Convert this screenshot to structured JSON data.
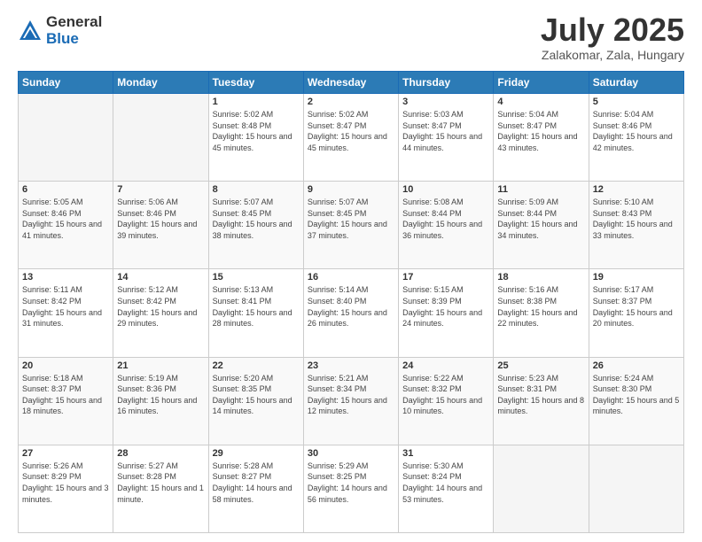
{
  "header": {
    "logo_general": "General",
    "logo_blue": "Blue",
    "title": "July 2025",
    "location": "Zalakomar, Zala, Hungary"
  },
  "days_of_week": [
    "Sunday",
    "Monday",
    "Tuesday",
    "Wednesday",
    "Thursday",
    "Friday",
    "Saturday"
  ],
  "weeks": [
    {
      "days": [
        {
          "num": "",
          "info": ""
        },
        {
          "num": "",
          "info": ""
        },
        {
          "num": "1",
          "sunrise": "5:02 AM",
          "sunset": "8:48 PM",
          "daylight": "15 hours and 45 minutes."
        },
        {
          "num": "2",
          "sunrise": "5:02 AM",
          "sunset": "8:47 PM",
          "daylight": "15 hours and 45 minutes."
        },
        {
          "num": "3",
          "sunrise": "5:03 AM",
          "sunset": "8:47 PM",
          "daylight": "15 hours and 44 minutes."
        },
        {
          "num": "4",
          "sunrise": "5:04 AM",
          "sunset": "8:47 PM",
          "daylight": "15 hours and 43 minutes."
        },
        {
          "num": "5",
          "sunrise": "5:04 AM",
          "sunset": "8:46 PM",
          "daylight": "15 hours and 42 minutes."
        }
      ]
    },
    {
      "shade": true,
      "days": [
        {
          "num": "6",
          "sunrise": "5:05 AM",
          "sunset": "8:46 PM",
          "daylight": "15 hours and 41 minutes."
        },
        {
          "num": "7",
          "sunrise": "5:06 AM",
          "sunset": "8:46 PM",
          "daylight": "15 hours and 39 minutes."
        },
        {
          "num": "8",
          "sunrise": "5:07 AM",
          "sunset": "8:45 PM",
          "daylight": "15 hours and 38 minutes."
        },
        {
          "num": "9",
          "sunrise": "5:07 AM",
          "sunset": "8:45 PM",
          "daylight": "15 hours and 37 minutes."
        },
        {
          "num": "10",
          "sunrise": "5:08 AM",
          "sunset": "8:44 PM",
          "daylight": "15 hours and 36 minutes."
        },
        {
          "num": "11",
          "sunrise": "5:09 AM",
          "sunset": "8:44 PM",
          "daylight": "15 hours and 34 minutes."
        },
        {
          "num": "12",
          "sunrise": "5:10 AM",
          "sunset": "8:43 PM",
          "daylight": "15 hours and 33 minutes."
        }
      ]
    },
    {
      "days": [
        {
          "num": "13",
          "sunrise": "5:11 AM",
          "sunset": "8:42 PM",
          "daylight": "15 hours and 31 minutes."
        },
        {
          "num": "14",
          "sunrise": "5:12 AM",
          "sunset": "8:42 PM",
          "daylight": "15 hours and 29 minutes."
        },
        {
          "num": "15",
          "sunrise": "5:13 AM",
          "sunset": "8:41 PM",
          "daylight": "15 hours and 28 minutes."
        },
        {
          "num": "16",
          "sunrise": "5:14 AM",
          "sunset": "8:40 PM",
          "daylight": "15 hours and 26 minutes."
        },
        {
          "num": "17",
          "sunrise": "5:15 AM",
          "sunset": "8:39 PM",
          "daylight": "15 hours and 24 minutes."
        },
        {
          "num": "18",
          "sunrise": "5:16 AM",
          "sunset": "8:38 PM",
          "daylight": "15 hours and 22 minutes."
        },
        {
          "num": "19",
          "sunrise": "5:17 AM",
          "sunset": "8:37 PM",
          "daylight": "15 hours and 20 minutes."
        }
      ]
    },
    {
      "shade": true,
      "days": [
        {
          "num": "20",
          "sunrise": "5:18 AM",
          "sunset": "8:37 PM",
          "daylight": "15 hours and 18 minutes."
        },
        {
          "num": "21",
          "sunrise": "5:19 AM",
          "sunset": "8:36 PM",
          "daylight": "15 hours and 16 minutes."
        },
        {
          "num": "22",
          "sunrise": "5:20 AM",
          "sunset": "8:35 PM",
          "daylight": "15 hours and 14 minutes."
        },
        {
          "num": "23",
          "sunrise": "5:21 AM",
          "sunset": "8:34 PM",
          "daylight": "15 hours and 12 minutes."
        },
        {
          "num": "24",
          "sunrise": "5:22 AM",
          "sunset": "8:32 PM",
          "daylight": "15 hours and 10 minutes."
        },
        {
          "num": "25",
          "sunrise": "5:23 AM",
          "sunset": "8:31 PM",
          "daylight": "15 hours and 8 minutes."
        },
        {
          "num": "26",
          "sunrise": "5:24 AM",
          "sunset": "8:30 PM",
          "daylight": "15 hours and 5 minutes."
        }
      ]
    },
    {
      "days": [
        {
          "num": "27",
          "sunrise": "5:26 AM",
          "sunset": "8:29 PM",
          "daylight": "15 hours and 3 minutes."
        },
        {
          "num": "28",
          "sunrise": "5:27 AM",
          "sunset": "8:28 PM",
          "daylight": "15 hours and 1 minute."
        },
        {
          "num": "29",
          "sunrise": "5:28 AM",
          "sunset": "8:27 PM",
          "daylight": "14 hours and 58 minutes."
        },
        {
          "num": "30",
          "sunrise": "5:29 AM",
          "sunset": "8:25 PM",
          "daylight": "14 hours and 56 minutes."
        },
        {
          "num": "31",
          "sunrise": "5:30 AM",
          "sunset": "8:24 PM",
          "daylight": "14 hours and 53 minutes."
        },
        {
          "num": "",
          "info": ""
        },
        {
          "num": "",
          "info": ""
        }
      ]
    }
  ]
}
